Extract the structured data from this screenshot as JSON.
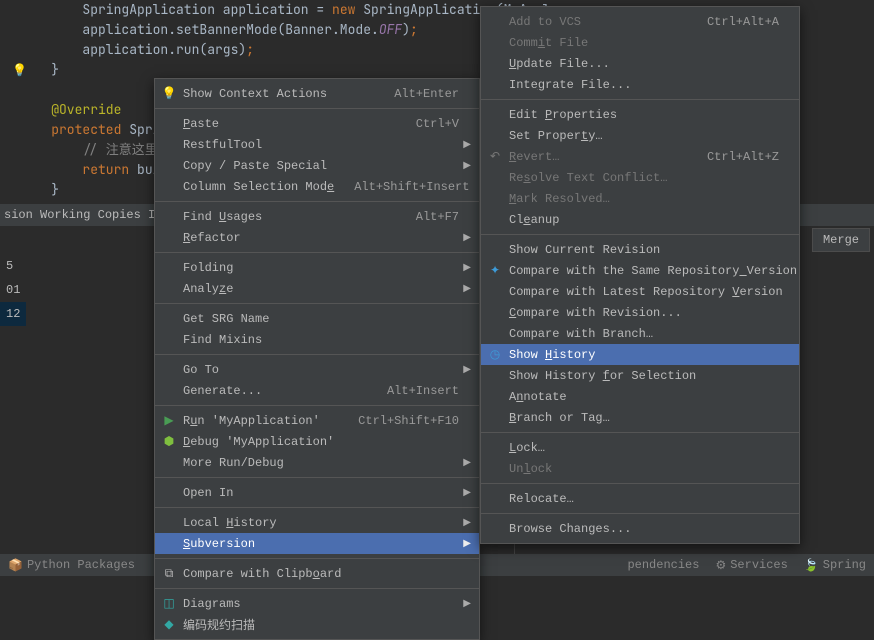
{
  "editor": {
    "lines": [
      "        SpringApplication application = new SpringApplication(MyAppl",
      "        application.setBannerMode(Banner.Mode.OFF);",
      "        application.run(args);",
      "    }",
      "",
      "    @Override",
      "    protected SpringAppl",
      "        // 注意这里要指向",
      "        return builder",
      "    }"
    ]
  },
  "bottom_tabs": "sion Working Copies In",
  "merge_label": "Merge",
  "revisions": [
    "5",
    "01",
    "12"
  ],
  "status_items": {
    "packages": "Python Packages",
    "dep": "pendencies",
    "services": "Services",
    "spring": "Spring"
  },
  "menu1": [
    {
      "label": "Show Context Actions",
      "shortcut": "Alt+Enter",
      "icon": "bulb"
    },
    {
      "sep": true
    },
    {
      "label": "Paste",
      "shortcut": "Ctrl+V",
      "u": 0
    },
    {
      "label": "RestfulTool",
      "arrow": true
    },
    {
      "label": "Copy / Paste Special",
      "arrow": true
    },
    {
      "label": "Column Selection Mode",
      "shortcut": "Alt+Shift+Insert",
      "u": 20
    },
    {
      "sep": true
    },
    {
      "label": "Find Usages",
      "shortcut": "Alt+F7",
      "u": 5
    },
    {
      "label": "Refactor",
      "arrow": true,
      "u": 0
    },
    {
      "sep": true
    },
    {
      "label": "Folding",
      "arrow": true
    },
    {
      "label": "Analyze",
      "arrow": true,
      "u": 5
    },
    {
      "sep": true
    },
    {
      "label": "Get SRG Name"
    },
    {
      "label": "Find Mixins"
    },
    {
      "sep": true
    },
    {
      "label": "Go To",
      "arrow": true
    },
    {
      "label": "Generate...",
      "shortcut": "Alt+Insert"
    },
    {
      "sep": true
    },
    {
      "label": "Run 'MyApplication'",
      "shortcut": "Ctrl+Shift+F10",
      "icon": "run",
      "u": 1
    },
    {
      "label": "Debug 'MyApplication'",
      "icon": "bug",
      "u": 0
    },
    {
      "label": "More Run/Debug",
      "arrow": true
    },
    {
      "sep": true
    },
    {
      "label": "Open In",
      "arrow": true
    },
    {
      "sep": true
    },
    {
      "label": "Local History",
      "arrow": true,
      "u": 6
    },
    {
      "label": "Subversion",
      "arrow": true,
      "sel": true,
      "u": 0
    },
    {
      "sep": true
    },
    {
      "label": "Compare with Clipboard",
      "icon": "compare",
      "u": 18
    },
    {
      "sep": true
    },
    {
      "label": "Diagrams",
      "arrow": true,
      "icon": "diagram"
    },
    {
      "label": "编码规约扫描",
      "icon": "scan"
    }
  ],
  "menu2": [
    {
      "label": "Add to VCS",
      "shortcut": "Ctrl+Alt+A",
      "disabled": true
    },
    {
      "label": "Commit File",
      "disabled": true,
      "u": 4
    },
    {
      "label": "Update File...",
      "u": 0
    },
    {
      "label": "Integrate File...",
      "u": 4
    },
    {
      "sep": true
    },
    {
      "label": "Edit Properties",
      "u": 5
    },
    {
      "label": "Set Property…",
      "u": 10
    },
    {
      "label": "Revert…",
      "shortcut": "Ctrl+Alt+Z",
      "icon": "revert",
      "disabled": true,
      "u": 0
    },
    {
      "label": "Resolve Text Conflict…",
      "disabled": true,
      "u": 2
    },
    {
      "label": "Mark Resolved…",
      "disabled": true,
      "u": 0
    },
    {
      "label": "Cleanup",
      "u": 2
    },
    {
      "sep": true
    },
    {
      "label": "Show Current Revision"
    },
    {
      "label": "Compare with the Same Repository Version",
      "icon": "compare-blue",
      "u": 32
    },
    {
      "label": "Compare with Latest Repository Version",
      "u": 31
    },
    {
      "label": "Compare with Revision...",
      "u": 0
    },
    {
      "label": "Compare with Branch…"
    },
    {
      "label": "Show History",
      "icon": "clock",
      "sel": true,
      "u": 5
    },
    {
      "label": "Show History for Selection",
      "u": 13
    },
    {
      "label": "Annotate",
      "u": 1
    },
    {
      "label": "Branch or Tag…",
      "u": 0
    },
    {
      "sep": true
    },
    {
      "label": "Lock…",
      "u": 0
    },
    {
      "label": "Unlock",
      "disabled": true,
      "u": 2
    },
    {
      "sep": true
    },
    {
      "label": "Relocate…"
    },
    {
      "sep": true
    },
    {
      "label": "Browse Changes..."
    }
  ]
}
